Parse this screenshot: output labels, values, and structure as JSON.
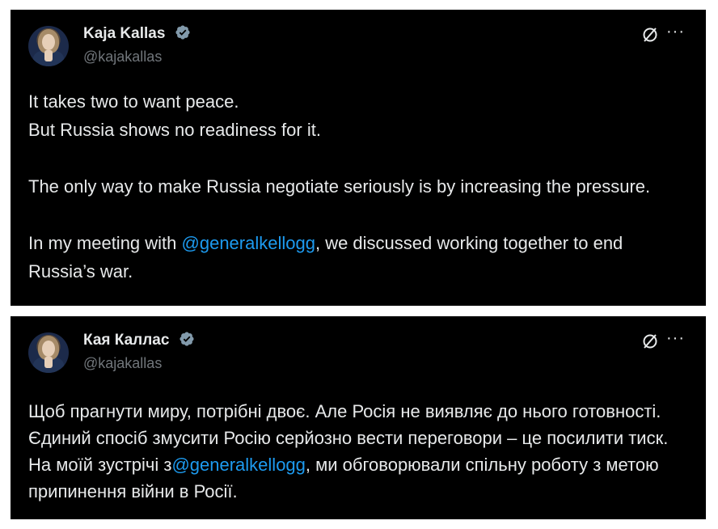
{
  "tweet1": {
    "author_name": "Kaja Kallas",
    "handle": "@kajakallas",
    "para1_line1": "It takes two to want peace.",
    "para1_line2": "But Russia shows no readiness for it.",
    "para2": "The only way to make Russia negotiate seriously is by increasing the pressure.",
    "para3_before": "In my meeting with ",
    "para3_mention": "@generalkellogg",
    "para3_after": ", we discussed working together to end Russia’s war.",
    "more_label": "···"
  },
  "tweet2": {
    "author_name": "Кая Каллас",
    "handle": "@kajakallas",
    "text_before": "Щоб прагнути миру, потрібні двоє. Але Росія не виявляє до нього готовності. Єдиний спосіб змусити Росію серйозно вести переговори – це посилити тиск. На моїй зустрічі з",
    "text_mention": "@generalkellogg",
    "text_after": ", ми обговорювали спільну роботу з метою припинення війни в Росії.",
    "more_label": "···"
  },
  "colors": {
    "background": "#000000",
    "text": "#e7e9ea",
    "muted": "#71767b",
    "link": "#1d9bf0",
    "verified": "#829aab"
  },
  "icons": [
    "verified-badge-icon",
    "grok-icon",
    "more-icon"
  ]
}
